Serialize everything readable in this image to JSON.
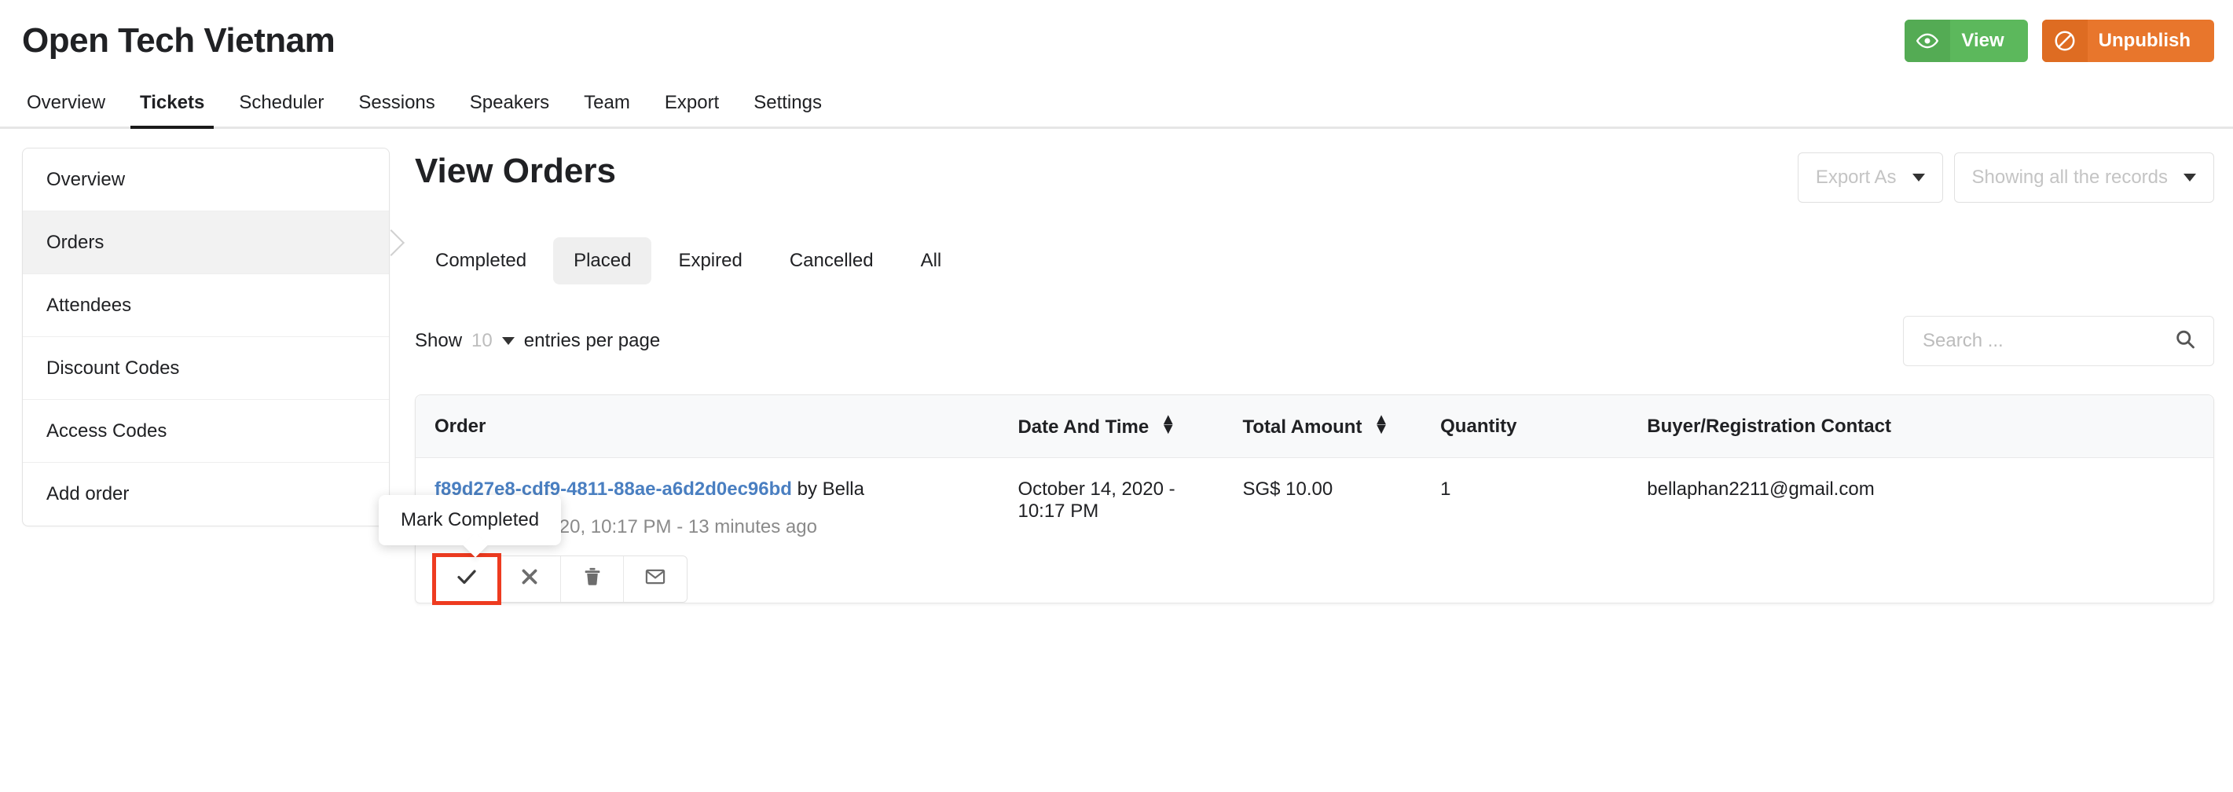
{
  "header": {
    "event_title": "Open Tech Vietnam",
    "view_button": {
      "label": "View",
      "icon": "eye-icon",
      "color": "#5cb85c"
    },
    "unpublish_button": {
      "label": "Unpublish",
      "icon": "no-entry-icon",
      "color": "#e8762c"
    }
  },
  "nav_tabs": [
    {
      "label": "Overview",
      "active": false
    },
    {
      "label": "Tickets",
      "active": true
    },
    {
      "label": "Scheduler",
      "active": false
    },
    {
      "label": "Sessions",
      "active": false
    },
    {
      "label": "Speakers",
      "active": false
    },
    {
      "label": "Team",
      "active": false
    },
    {
      "label": "Export",
      "active": false
    },
    {
      "label": "Settings",
      "active": false
    }
  ],
  "sidebar": {
    "items": [
      {
        "label": "Overview",
        "active": false
      },
      {
        "label": "Orders",
        "active": true
      },
      {
        "label": "Attendees",
        "active": false
      },
      {
        "label": "Discount Codes",
        "active": false
      },
      {
        "label": "Access Codes",
        "active": false
      },
      {
        "label": "Add order",
        "active": false
      }
    ]
  },
  "main": {
    "page_title": "View Orders",
    "export_as": {
      "label": "Export As"
    },
    "records_filter": {
      "label": "Showing all the records"
    },
    "filter_tabs": [
      {
        "label": "Completed",
        "active": false
      },
      {
        "label": "Placed",
        "active": true
      },
      {
        "label": "Expired",
        "active": false
      },
      {
        "label": "Cancelled",
        "active": false
      },
      {
        "label": "All",
        "active": false
      }
    ],
    "show_entries": {
      "prefix": "Show",
      "count": "10",
      "suffix": "entries per page"
    },
    "search": {
      "placeholder": "Search ...",
      "value": ""
    },
    "table": {
      "columns": [
        {
          "label": "Order",
          "sortable": false
        },
        {
          "label": "Date And Time",
          "sortable": true
        },
        {
          "label": "Total Amount",
          "sortable": true
        },
        {
          "label": "Quantity",
          "sortable": false
        },
        {
          "label": "Buyer/Registration Contact",
          "sortable": false
        }
      ],
      "rows": [
        {
          "order_id": "f89d27e8-cdf9-4811-88ae-a6d2d0ec96bd",
          "order_by": " by Bella",
          "order_sub": "October 14, 2020, 10:17 PM - 13 minutes ago",
          "date_and_time": "October 14, 2020 - 10:17 PM",
          "total_amount": "SG$ 10.00",
          "quantity": "1",
          "buyer_contact": "bellaphan2211@gmail.com",
          "actions": [
            {
              "name": "mark-completed",
              "icon": "check-icon",
              "highlighted": true
            },
            {
              "name": "cancel-order",
              "icon": "x-icon",
              "highlighted": false
            },
            {
              "name": "delete-order",
              "icon": "trash-icon",
              "highlighted": false
            },
            {
              "name": "resend-email",
              "icon": "envelope-icon",
              "highlighted": false
            }
          ]
        }
      ]
    },
    "tooltip": {
      "text": "Mark Completed"
    }
  },
  "colors": {
    "link": "#4a7fc1",
    "highlight_border": "#ee3b20",
    "green": "#5cb85c",
    "orange": "#e8762c"
  }
}
